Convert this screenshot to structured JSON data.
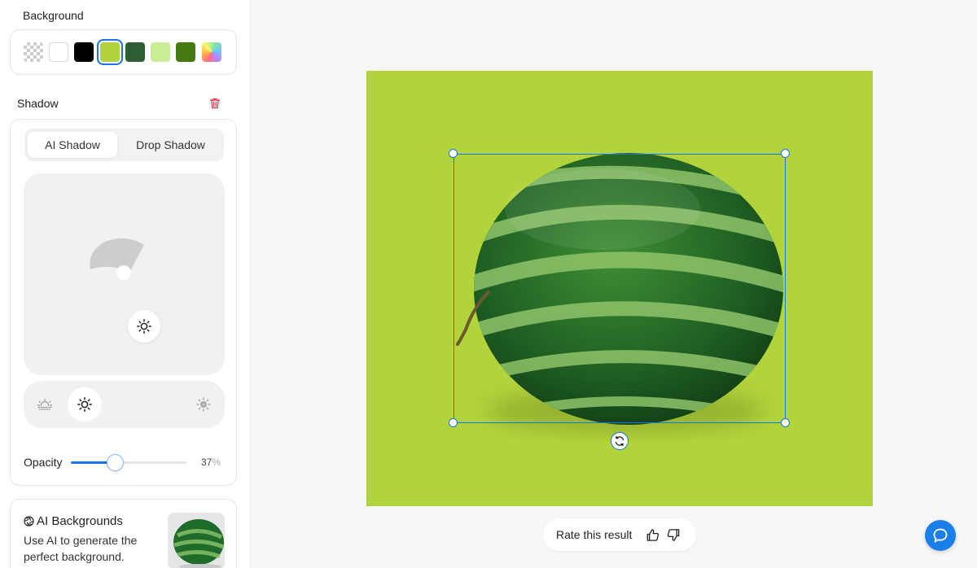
{
  "sidebar": {
    "background": {
      "title": "Background",
      "swatches": [
        {
          "name": "transparent",
          "color": "checker"
        },
        {
          "name": "white",
          "color": "#ffffff"
        },
        {
          "name": "black",
          "color": "#000000"
        },
        {
          "name": "lime",
          "color": "#b1d33b",
          "selected": true
        },
        {
          "name": "dark-green",
          "color": "#2e5d34"
        },
        {
          "name": "light-green",
          "color": "#c9ee93"
        },
        {
          "name": "green",
          "color": "#467a12"
        },
        {
          "name": "rainbow",
          "color": "gradient"
        }
      ]
    },
    "shadow": {
      "title": "Shadow",
      "delete_icon": "trash-icon",
      "tabs": [
        {
          "label": "AI Shadow",
          "active": true
        },
        {
          "label": "Drop Shadow",
          "active": false
        }
      ],
      "opacity_label": "Opacity",
      "opacity_value": "37",
      "opacity_unit": "%",
      "opacity_fraction": 0.37
    },
    "ai_backgrounds": {
      "title": "AI Backgrounds",
      "description": "Use AI to generate the perfect background."
    }
  },
  "canvas": {
    "background_color": "#b1d33b"
  },
  "rate": {
    "label": "Rate this result"
  },
  "colors": {
    "accent": "#1a73e8",
    "help_button": "#1a7fe8"
  }
}
